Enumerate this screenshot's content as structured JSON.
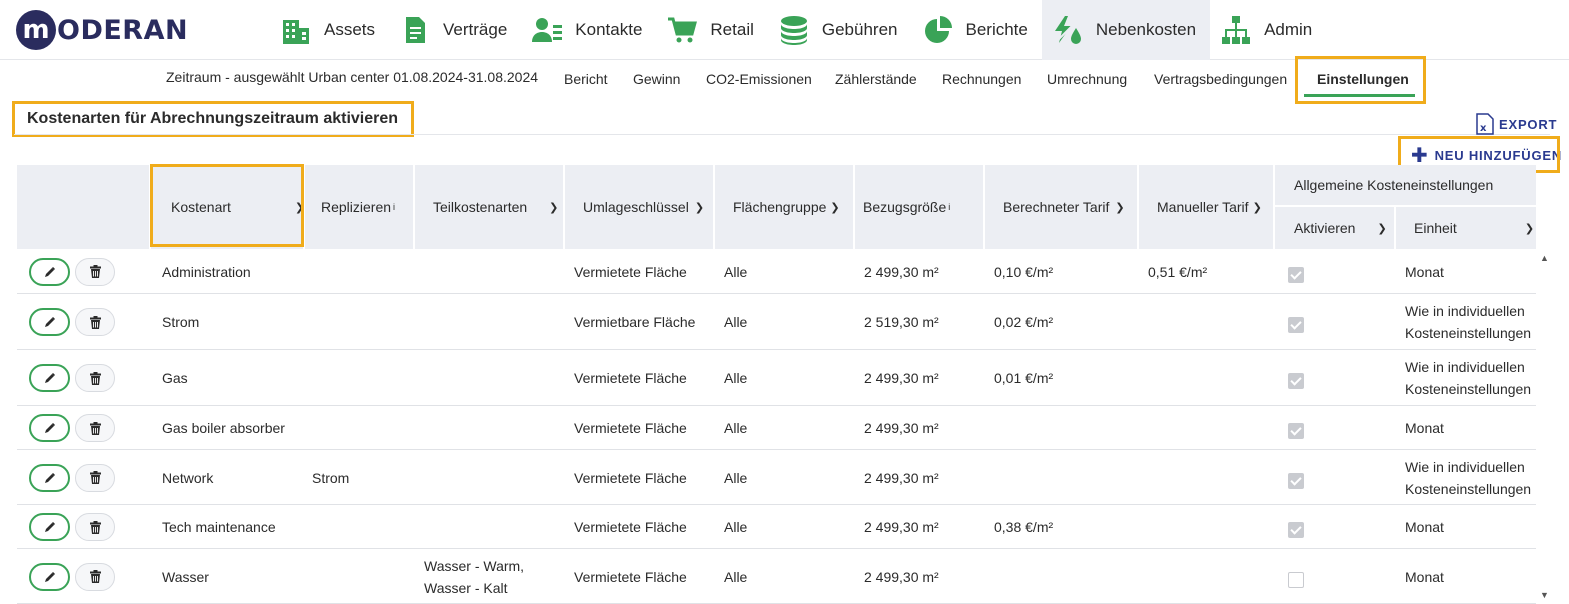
{
  "brand": {
    "letter": "m",
    "name": "ODERAN"
  },
  "nav": [
    {
      "label": "Assets",
      "icon": "building-icon"
    },
    {
      "label": "Verträge",
      "icon": "document-icon"
    },
    {
      "label": "Kontakte",
      "icon": "contacts-icon"
    },
    {
      "label": "Retail",
      "icon": "cart-icon"
    },
    {
      "label": "Gebühren",
      "icon": "coins-icon"
    },
    {
      "label": "Berichte",
      "icon": "pie-chart-icon"
    },
    {
      "label": "Nebenkosten",
      "icon": "utilities-icon",
      "active": true
    },
    {
      "label": "Admin",
      "icon": "org-chart-icon"
    }
  ],
  "subnav": {
    "period": "Zeitraum - ausgewählt Urban center 01.08.2024-31.08.2024",
    "tabs": [
      "Bericht",
      "Gewinn",
      "CO2-Emissionen",
      "Zählerstände",
      "Rechnungen",
      "Umrechnung",
      "Vertragsbedingungen",
      "Einstellungen"
    ],
    "active_tab": "Einstellungen"
  },
  "section": {
    "title": "Kostenarten für Abrechnungszeitraum aktivieren",
    "export_label": "EXPORT",
    "add_label": "NEU HINZUFÜGEN"
  },
  "table": {
    "headers": {
      "kostenart": "Kostenart",
      "replizieren": "Replizieren",
      "teilkostenarten": "Teilkostenarten",
      "umlageschluessel": "Umlageschlüssel",
      "flaechengruppe": "Flächengruppe",
      "bezugsgroesse": "Bezugsgröße",
      "berechneter_tarif": "Berechneter Tarif",
      "manueller_tarif": "Manueller Tarif",
      "allgemein": "Allgemeine Kosteneinstellungen",
      "aktivieren": "Aktivieren",
      "einheit": "Einheit",
      "info": "i"
    },
    "rows": [
      {
        "kostenart": "Administration",
        "replizieren": "",
        "teil1": "",
        "teil2": "",
        "umlage": "Vermietete Fläche",
        "gruppe": "Alle",
        "bezug": "2 499,30 m²",
        "berechnet": "0,10 €/m²",
        "manuell": "0,51 €/m²",
        "aktiv": true,
        "einheit1": "Monat",
        "einheit2": ""
      },
      {
        "kostenart": "Strom",
        "replizieren": "",
        "teil1": "",
        "teil2": "",
        "umlage": "Vermietbare Fläche",
        "gruppe": "Alle",
        "bezug": "2 519,30 m²",
        "berechnet": "0,02 €/m²",
        "manuell": "",
        "aktiv": true,
        "einheit1": "Wie in individuellen",
        "einheit2": "Kosteneinstellungen"
      },
      {
        "kostenart": "Gas",
        "replizieren": "",
        "teil1": "",
        "teil2": "",
        "umlage": "Vermietete Fläche",
        "gruppe": "Alle",
        "bezug": "2 499,30 m²",
        "berechnet": "0,01 €/m²",
        "manuell": "",
        "aktiv": true,
        "einheit1": "Wie in individuellen",
        "einheit2": "Kosteneinstellungen"
      },
      {
        "kostenart": "Gas boiler absorber",
        "replizieren": "",
        "teil1": "",
        "teil2": "",
        "umlage": "Vermietete Fläche",
        "gruppe": "Alle",
        "bezug": "2 499,30 m²",
        "berechnet": "",
        "manuell": "",
        "aktiv": true,
        "einheit1": "Monat",
        "einheit2": ""
      },
      {
        "kostenart": "Network",
        "replizieren": "Strom",
        "teil1": "",
        "teil2": "",
        "umlage": "Vermietete Fläche",
        "gruppe": "Alle",
        "bezug": "2 499,30 m²",
        "berechnet": "",
        "manuell": "",
        "aktiv": true,
        "einheit1": "Wie in individuellen",
        "einheit2": "Kosteneinstellungen"
      },
      {
        "kostenart": "Tech maintenance",
        "replizieren": "",
        "teil1": "",
        "teil2": "",
        "umlage": "Vermietete Fläche",
        "gruppe": "Alle",
        "bezug": "2 499,30 m²",
        "berechnet": "0,38 €/m²",
        "manuell": "",
        "aktiv": true,
        "einheit1": "Monat",
        "einheit2": ""
      },
      {
        "kostenart": "Wasser",
        "replizieren": "",
        "teil1": "Wasser - Warm,",
        "teil2": "Wasser - Kalt",
        "umlage": "Vermietete Fläche",
        "gruppe": "Alle",
        "bezug": "2 499,30 m²",
        "berechnet": "",
        "manuell": "",
        "aktiv": false,
        "einheit1": "Monat",
        "einheit2": ""
      }
    ]
  },
  "colors": {
    "brand": "#2a2c5e",
    "accent": "#3aa357",
    "highlight": "#f0ac1b",
    "link": "#2a3a8f"
  }
}
